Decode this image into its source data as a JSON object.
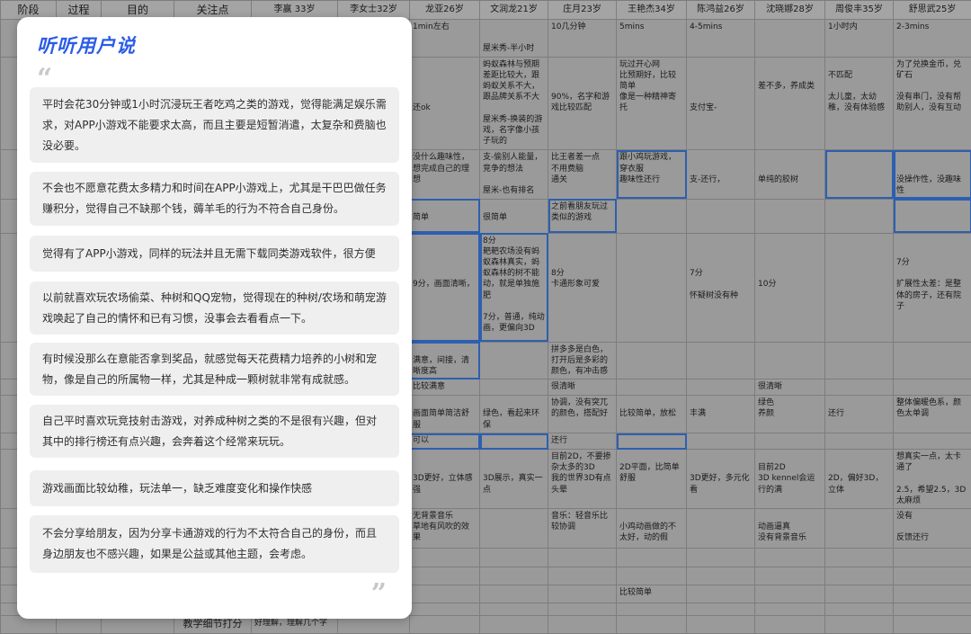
{
  "header": [
    "阶段",
    "过程",
    "目的",
    "关注点",
    "李赢 33岁",
    "李女士32岁",
    "龙亚26岁",
    "文润龙21岁",
    "庄月23岁",
    "王艳杰34岁",
    "陈鸿益26岁",
    "沈晓娜28岁",
    "周俊丰35岁",
    "舒思武25岁"
  ],
  "rows": [
    [
      "",
      "",
      "",
      "",
      "",
      "",
      "1min左右",
      "\n\n屋米秀-半小时",
      "10几分钟",
      "5mins",
      "4-5mins",
      "",
      "1小时内",
      "2-3mins"
    ],
    [
      "",
      "",
      "",
      "",
      "",
      "",
      "\n\n\n\n还ok",
      "蚂蚁森林与预期差距比较大，跟蚂蚁关系不大，跟品牌关系不大\n\n屋米秀-换装的游戏，名字像小孩子玩的",
      "\n\n\n90%，名字和游戏比较匹配",
      "玩过开心网\n比预期好，比较简单\n像是一种精神寄托",
      "\n\n\n\n支付宝-",
      "\n\n差不多，养成类",
      "\n不匹配\n\n太儿童，太幼稚，没有体验感",
      "为了兑换金币，兑矿石\n\n没有串门，没有帮助别人，没有互动"
    ],
    [
      "",
      "",
      "",
      "",
      "",
      "",
      "没什么趣味性，想完成自己的理想",
      "支-偷别人能量，竞争的想法\n\n屋米-也有排名",
      "比王者差一点\n不用费脑\n通关",
      "跟小鸡玩游戏，穿衣服\n趣味性还行",
      "\n\n支-还行，",
      "\n\n单纯的胶树",
      "",
      "\n\n没操作性，没趣味性"
    ],
    [
      "",
      "",
      "",
      "",
      "",
      "",
      "\n简单",
      "\n很简单",
      "之前看朋友玩过类似的游戏",
      "",
      "",
      "",
      "",
      ""
    ],
    [
      "",
      "",
      "",
      "",
      "",
      "",
      "\n\n\n\n9分，画面清晰，",
      "8分\n耙耙农场没有蚂蚁森林真实，蚂蚁森林的树不能动，就是单独施肥\n\n7分，普通，纯动画，更偏向3D",
      "\n\n\n8分\n卡通形象可爱",
      "",
      "\n\n\n7分\n\n怀疑树没有种",
      "\n\n\n\n10分",
      "",
      "\n\n7分\n\n扩展性太差：是整体的房子，还有院子"
    ],
    [
      "",
      "",
      "",
      "",
      "",
      "",
      "\n满意，间接，清晰度高",
      "",
      "拼多多是白色，打开后是多彩的颜色，有冲击感",
      "",
      "",
      "",
      "",
      ""
    ],
    [
      "",
      "",
      "",
      "",
      "",
      "",
      "比较满意",
      "",
      "很清晰",
      "",
      "",
      "很清晰",
      "",
      ""
    ],
    [
      "",
      "",
      "",
      "",
      "",
      "",
      "\n画面简单简洁舒服",
      "\n绿色，看起来环保",
      "协调，没有突兀的颜色，搭配好",
      "\n比较简单，放松",
      "\n丰满",
      "绿色\n养颜",
      "\n还行",
      "整体偏暖色系，颜色太单调"
    ],
    [
      "",
      "",
      "",
      "",
      "",
      "",
      "可以",
      "",
      "还行",
      "",
      "",
      "",
      "",
      ""
    ],
    [
      "",
      "",
      "",
      "",
      "",
      "",
      "\n\n3D更好，立体感强",
      "\n\n3D展示，真实一点",
      "目前2D，不要掺杂太多的3D\n我的世界3D有点头晕",
      "\n2D平面，比简单舒服",
      "\n\n3D更好，多元化看",
      "\n目前2D\n3D kennel会运行的满",
      "\n\n2D，偏好3D，立体",
      "想真实一点，太卡通了\n\n2.5，希望2.5，3D太麻烦"
    ],
    [
      "",
      "",
      "",
      "",
      "",
      "",
      "无背景音乐\n草地有风吹的效果",
      "",
      "音乐：轻音乐比较协调",
      "\n小鸡动画做的不太好，动的假",
      "",
      "\n动画逼真\n没有背景音乐",
      "",
      "没有\n\n反馈还行"
    ],
    [
      "",
      "",
      "",
      "",
      "",
      "",
      "",
      "",
      "",
      "",
      "",
      "",
      "",
      ""
    ],
    [
      "",
      "",
      "",
      "",
      "",
      "",
      "",
      "",
      "",
      "",
      "",
      "",
      "",
      ""
    ],
    [
      "",
      "",
      "",
      "",
      "",
      "",
      "",
      "",
      "",
      "比较简单",
      "",
      "",
      "",
      ""
    ],
    [
      "",
      "",
      "",
      "",
      "",
      "",
      "",
      "",
      "",
      "",
      "",
      "",
      "",
      ""
    ],
    [
      "",
      "",
      "",
      "教学细节打分",
      "好理解，理解几个字",
      "",
      "",
      "",
      "",
      "",
      "",
      "",
      "",
      ""
    ]
  ],
  "highlights": [
    "2-9",
    "2-12",
    "2-13",
    "3-6",
    "3-8",
    "3-13",
    "4-6",
    "4-7",
    "5-6",
    "8-6",
    "8-7",
    "8-9"
  ],
  "overlay": {
    "title": "听听用户说",
    "open_quote": "“",
    "close_quote": "”",
    "cards": [
      "平时会花30分钟或1小时沉浸玩王者吃鸡之类的游戏，觉得能满足娱乐需求，对APP小游戏不能要求太高，而且主要是短暂消遣，太复杂和费脑也没必要。",
      "不会也不愿意花费太多精力和时间在APP小游戏上，尤其是干巴巴做任务赚积分，觉得自己不缺那个钱，薅羊毛的行为不符合自己身份。",
      "觉得有了APP小游戏，同样的玩法并且无需下载同类游戏软件，很方便",
      "以前就喜欢玩农场偷菜、种树和QQ宠物，觉得现在的种树/农场和萌宠游戏唤起了自己的情怀和已有习惯，没事会去看看点一下。",
      "有时候没那么在意能否拿到奖品，就感觉每天花费精力培养的小树和宠物，像是自己的所属物一样，尤其是种成一颗树就非常有成就感。",
      "自己平时喜欢玩竞技射击游戏，对养成种树之类的不是很有兴趣，但对其中的排行榜还有点兴趣，会奔着这个经常来玩玩。",
      "游戏画面比较幼稚，玩法单一，缺乏难度变化和操作快感",
      "不会分享给朋友，因为分享卡通游戏的行为不太符合自己的身份，而且身边朋友也不感兴趣，如果是公益或其他主题，会考虑。"
    ]
  }
}
